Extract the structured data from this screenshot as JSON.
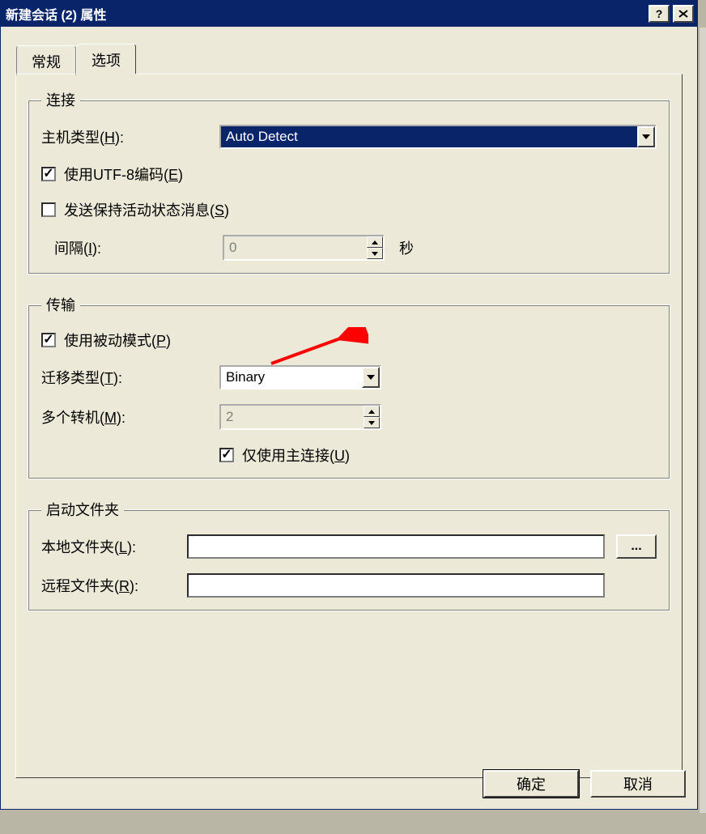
{
  "title": "新建会话 (2) 属性",
  "tabs": {
    "general": "常规",
    "options": "选项"
  },
  "groups": {
    "connection": {
      "legend": "连接",
      "host_type_label": "主机类型(",
      "host_type_key": "H",
      "host_type_suffix": "):",
      "host_type_value": "Auto Detect",
      "utf8_label": "使用UTF-8编码(",
      "utf8_key": "E",
      "utf8_suffix": ")",
      "keepalive_label": "发送保持活动状态消息(",
      "keepalive_key": "S",
      "keepalive_suffix": ")",
      "interval_label": "间隔(",
      "interval_key": "I",
      "interval_suffix": "):",
      "interval_value": "0",
      "seconds": "秒"
    },
    "transfer": {
      "legend": "传输",
      "passive_label": "使用被动模式(",
      "passive_key": "P",
      "passive_suffix": ")",
      "transfer_type_label": "迁移类型(",
      "transfer_type_key": "T",
      "transfer_type_suffix": "):",
      "transfer_type_value": "Binary",
      "proxies_label": "多个转机(",
      "proxies_key": "M",
      "proxies_suffix": "):",
      "proxies_value": "2",
      "main_conn_label": "仅使用主连接(",
      "main_conn_key": "U",
      "main_conn_suffix": ")"
    },
    "startup": {
      "legend": "启动文件夹",
      "local_label": "本地文件夹(",
      "local_key": "L",
      "local_suffix": "):",
      "remote_label": "远程文件夹(",
      "remote_key": "R",
      "remote_suffix": "):",
      "browse": "..."
    }
  },
  "buttons": {
    "ok": "确定",
    "cancel": "取消"
  }
}
